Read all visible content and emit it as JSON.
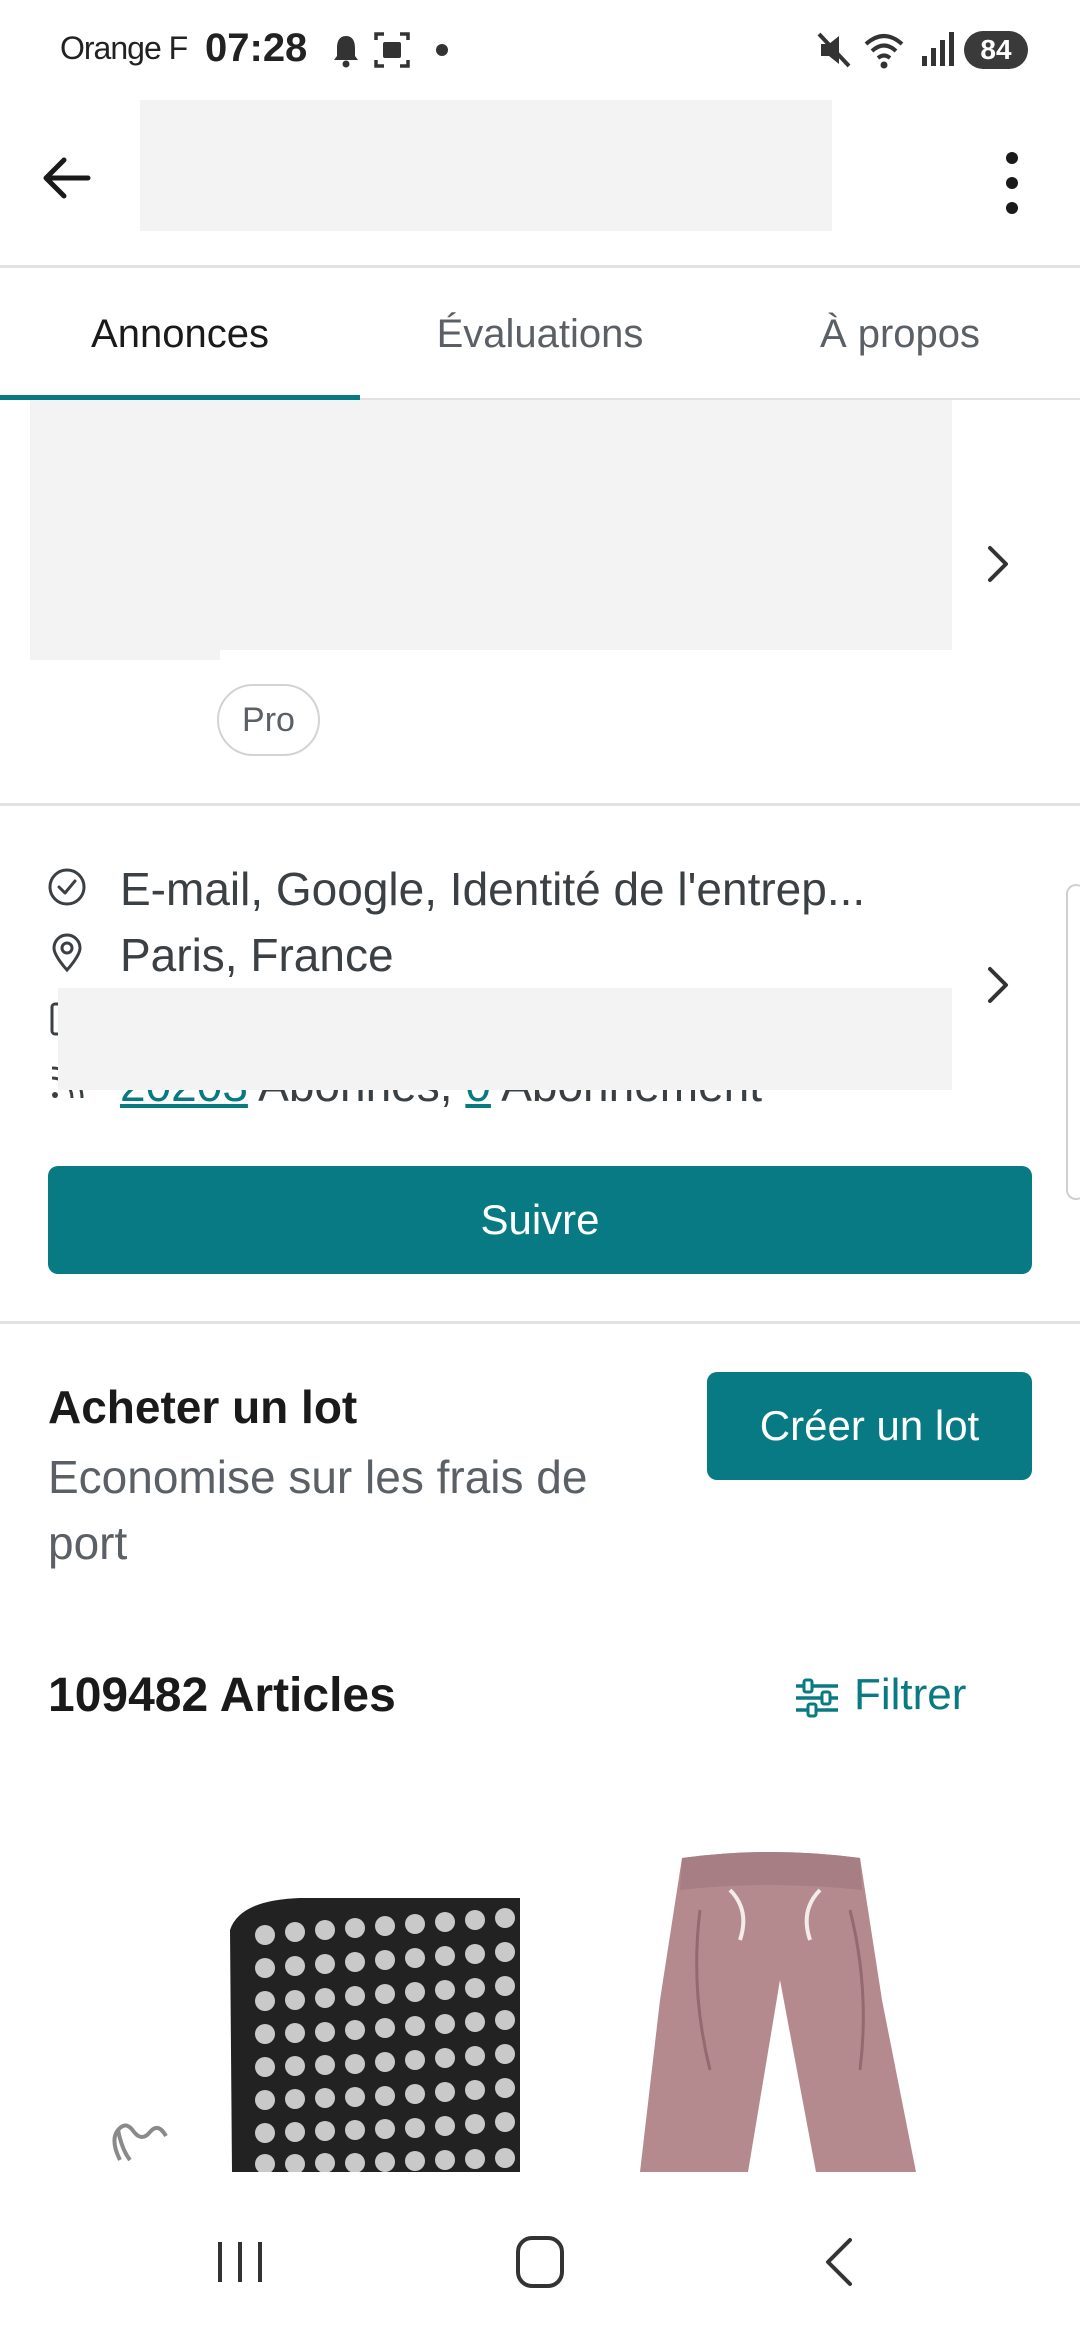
{
  "status_bar": {
    "carrier": "Orange F",
    "time": "07:28",
    "battery": "84",
    "icons": [
      "bell-icon",
      "screenshot-icon",
      "dot-icon",
      "mute-icon",
      "wifi-icon",
      "signal-icon"
    ]
  },
  "tabs": [
    {
      "label": "Annonces",
      "active": true
    },
    {
      "label": "Évaluations",
      "active": false
    },
    {
      "label": "À propos",
      "active": false
    }
  ],
  "profile": {
    "badge": "Pro"
  },
  "info": {
    "verified": "E-mail, Google, Identité de l'entrep...",
    "location": "Paris, France",
    "followers_count": "20203",
    "followers_label": "Abonnés,",
    "following_count": "0",
    "following_label": "Abonnement"
  },
  "follow_button": "Suivre",
  "bundle": {
    "title": "Acheter un lot",
    "subtitle": "Economise sur les frais de port",
    "button": "Créer un lot"
  },
  "articles": {
    "count_label": "109482 Articles",
    "filter_label": "Filtrer"
  },
  "colors": {
    "accent": "#077a84",
    "placeholder": "#f3f3f3",
    "divider": "#e2e2e2"
  }
}
